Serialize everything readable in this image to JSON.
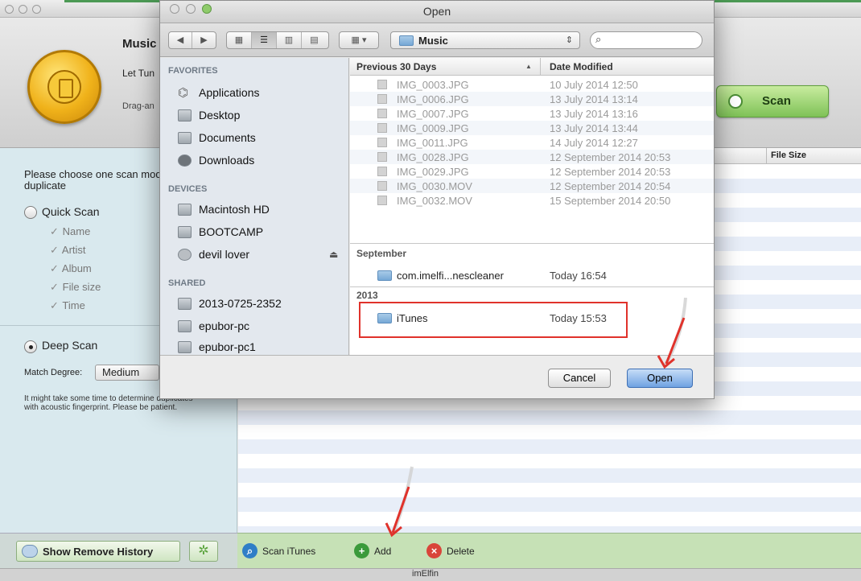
{
  "app": {
    "header_title": "Music",
    "header_subtitle": "Let Tun",
    "header_drag": "Drag-an",
    "scan_label": "Scan",
    "choose_text": "Please choose one scan mode to search duplicate",
    "quick_scan_label": "Quick Scan",
    "quick_scan_options": [
      "Name",
      "Artist",
      "Album",
      "File size",
      "Time"
    ],
    "deep_scan_label": "Deep Scan",
    "match_degree_label": "Match Degree:",
    "match_degree_value": "Medium",
    "deep_note": "It might take some time to determine duplicates with acoustic fingerprint. Please be patient.",
    "list_column_filesize": "File Size",
    "show_remove_history": "Show Remove History",
    "scan_itunes": "Scan iTunes",
    "add": "Add",
    "delete": "Delete",
    "brand": "imElfin"
  },
  "dialog": {
    "title": "Open",
    "path_folder": "Music",
    "search_placeholder": "",
    "sidebar": {
      "favorites_heading": "FAVORITES",
      "favorites": [
        "Applications",
        "Desktop",
        "Documents",
        "Downloads"
      ],
      "devices_heading": "DEVICES",
      "devices": [
        "Macintosh HD",
        "BOOTCAMP",
        "devil lover"
      ],
      "shared_heading": "SHARED",
      "shared": [
        "2013-0725-2352",
        "epubor-pc",
        "epubor-pc1"
      ]
    },
    "columns": {
      "name": "Previous 30 Days",
      "date": "Date Modified"
    },
    "recent_files": [
      {
        "name": "IMG_0003.JPG",
        "date": "10 July 2014 12:50"
      },
      {
        "name": "IMG_0006.JPG",
        "date": "13 July 2014 13:14"
      },
      {
        "name": "IMG_0007.JPG",
        "date": "13 July 2014 13:16"
      },
      {
        "name": "IMG_0009.JPG",
        "date": "13 July 2014 13:44"
      },
      {
        "name": "IMG_0011.JPG",
        "date": "14 July 2014 12:27"
      },
      {
        "name": "IMG_0028.JPG",
        "date": "12 September 2014 20:53"
      },
      {
        "name": "IMG_0029.JPG",
        "date": "12 September 2014 20:53"
      },
      {
        "name": "IMG_0030.MOV",
        "date": "12 September 2014 20:54"
      },
      {
        "name": "IMG_0032.MOV",
        "date": "15 September 2014 20:50"
      }
    ],
    "september_heading": "September",
    "september_folder": {
      "name": "com.imelfi...nescleaner",
      "date": "Today 16:54"
    },
    "year_heading": "2013",
    "year_folder": {
      "name": "iTunes",
      "date": "Today 15:53"
    },
    "cancel_label": "Cancel",
    "open_label": "Open"
  },
  "colors": {
    "highlight": "#e0322b",
    "arrow": "#e0322b",
    "toolbar_green": "#c6e1b6",
    "panel_blue": "#d9e9ee"
  }
}
